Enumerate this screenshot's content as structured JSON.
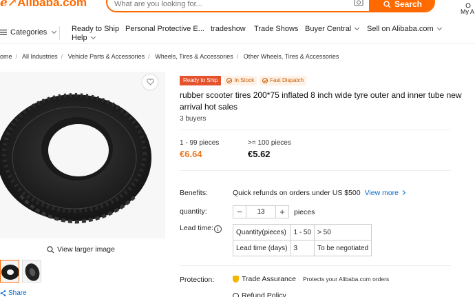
{
  "header": {
    "logo_text": "Alibaba.com",
    "search_placeholder": "What are you looking for...",
    "search_button": "Search",
    "account_label": "My A"
  },
  "nav": {
    "categories": "Categories",
    "items": [
      "Ready to Ship",
      "Personal Protective E...",
      "tradeshow",
      "Trade Shows",
      "Buyer Central",
      "Sell on Alibaba.com",
      "Help"
    ]
  },
  "breadcrumb": [
    "ome",
    "All Industries",
    "Vehicle Parts & Accessories",
    "Wheels, Tires & Accessories",
    "Other Wheels, Tires & Accessories"
  ],
  "gallery": {
    "view_larger": "View larger image",
    "share": "Share"
  },
  "product": {
    "badge_ready": "Ready to Ship",
    "badge_in_stock": "In Stock",
    "badge_fast_dispatch": "Fast Dispatch",
    "title": "rubber scooter tires 200*75 inflated 8 inch wide tyre outer and inner tube new arrival hot sales",
    "buyers": "3 buyers",
    "tiers": [
      {
        "range": "1 - 99 pieces",
        "price": "€6.64"
      },
      {
        "range": ">= 100 pieces",
        "price": "€5.62"
      }
    ],
    "benefits_label": "Benefits:",
    "benefits_text": "Quick refunds on orders under US $500",
    "benefits_link": "View more",
    "quantity_label": "quantity:",
    "quantity_value": "13",
    "quantity_unit": "pieces",
    "lead_time_label": "Lead time:",
    "lead_table": {
      "row1": [
        "Quantity(pieces)",
        "1 - 50",
        "> 50"
      ],
      "row2": [
        "Lead time (days)",
        "3",
        "To be negotiated"
      ]
    },
    "protection_label": "Protection:",
    "trade_assurance": "Trade Assurance",
    "trade_assurance_sub": "Protects your Alibaba.com orders",
    "refund_policy": "Refund Policy"
  },
  "colors": {
    "accent": "#ff6a00",
    "price_highlight": "#e87722",
    "link": "#0066cc"
  }
}
